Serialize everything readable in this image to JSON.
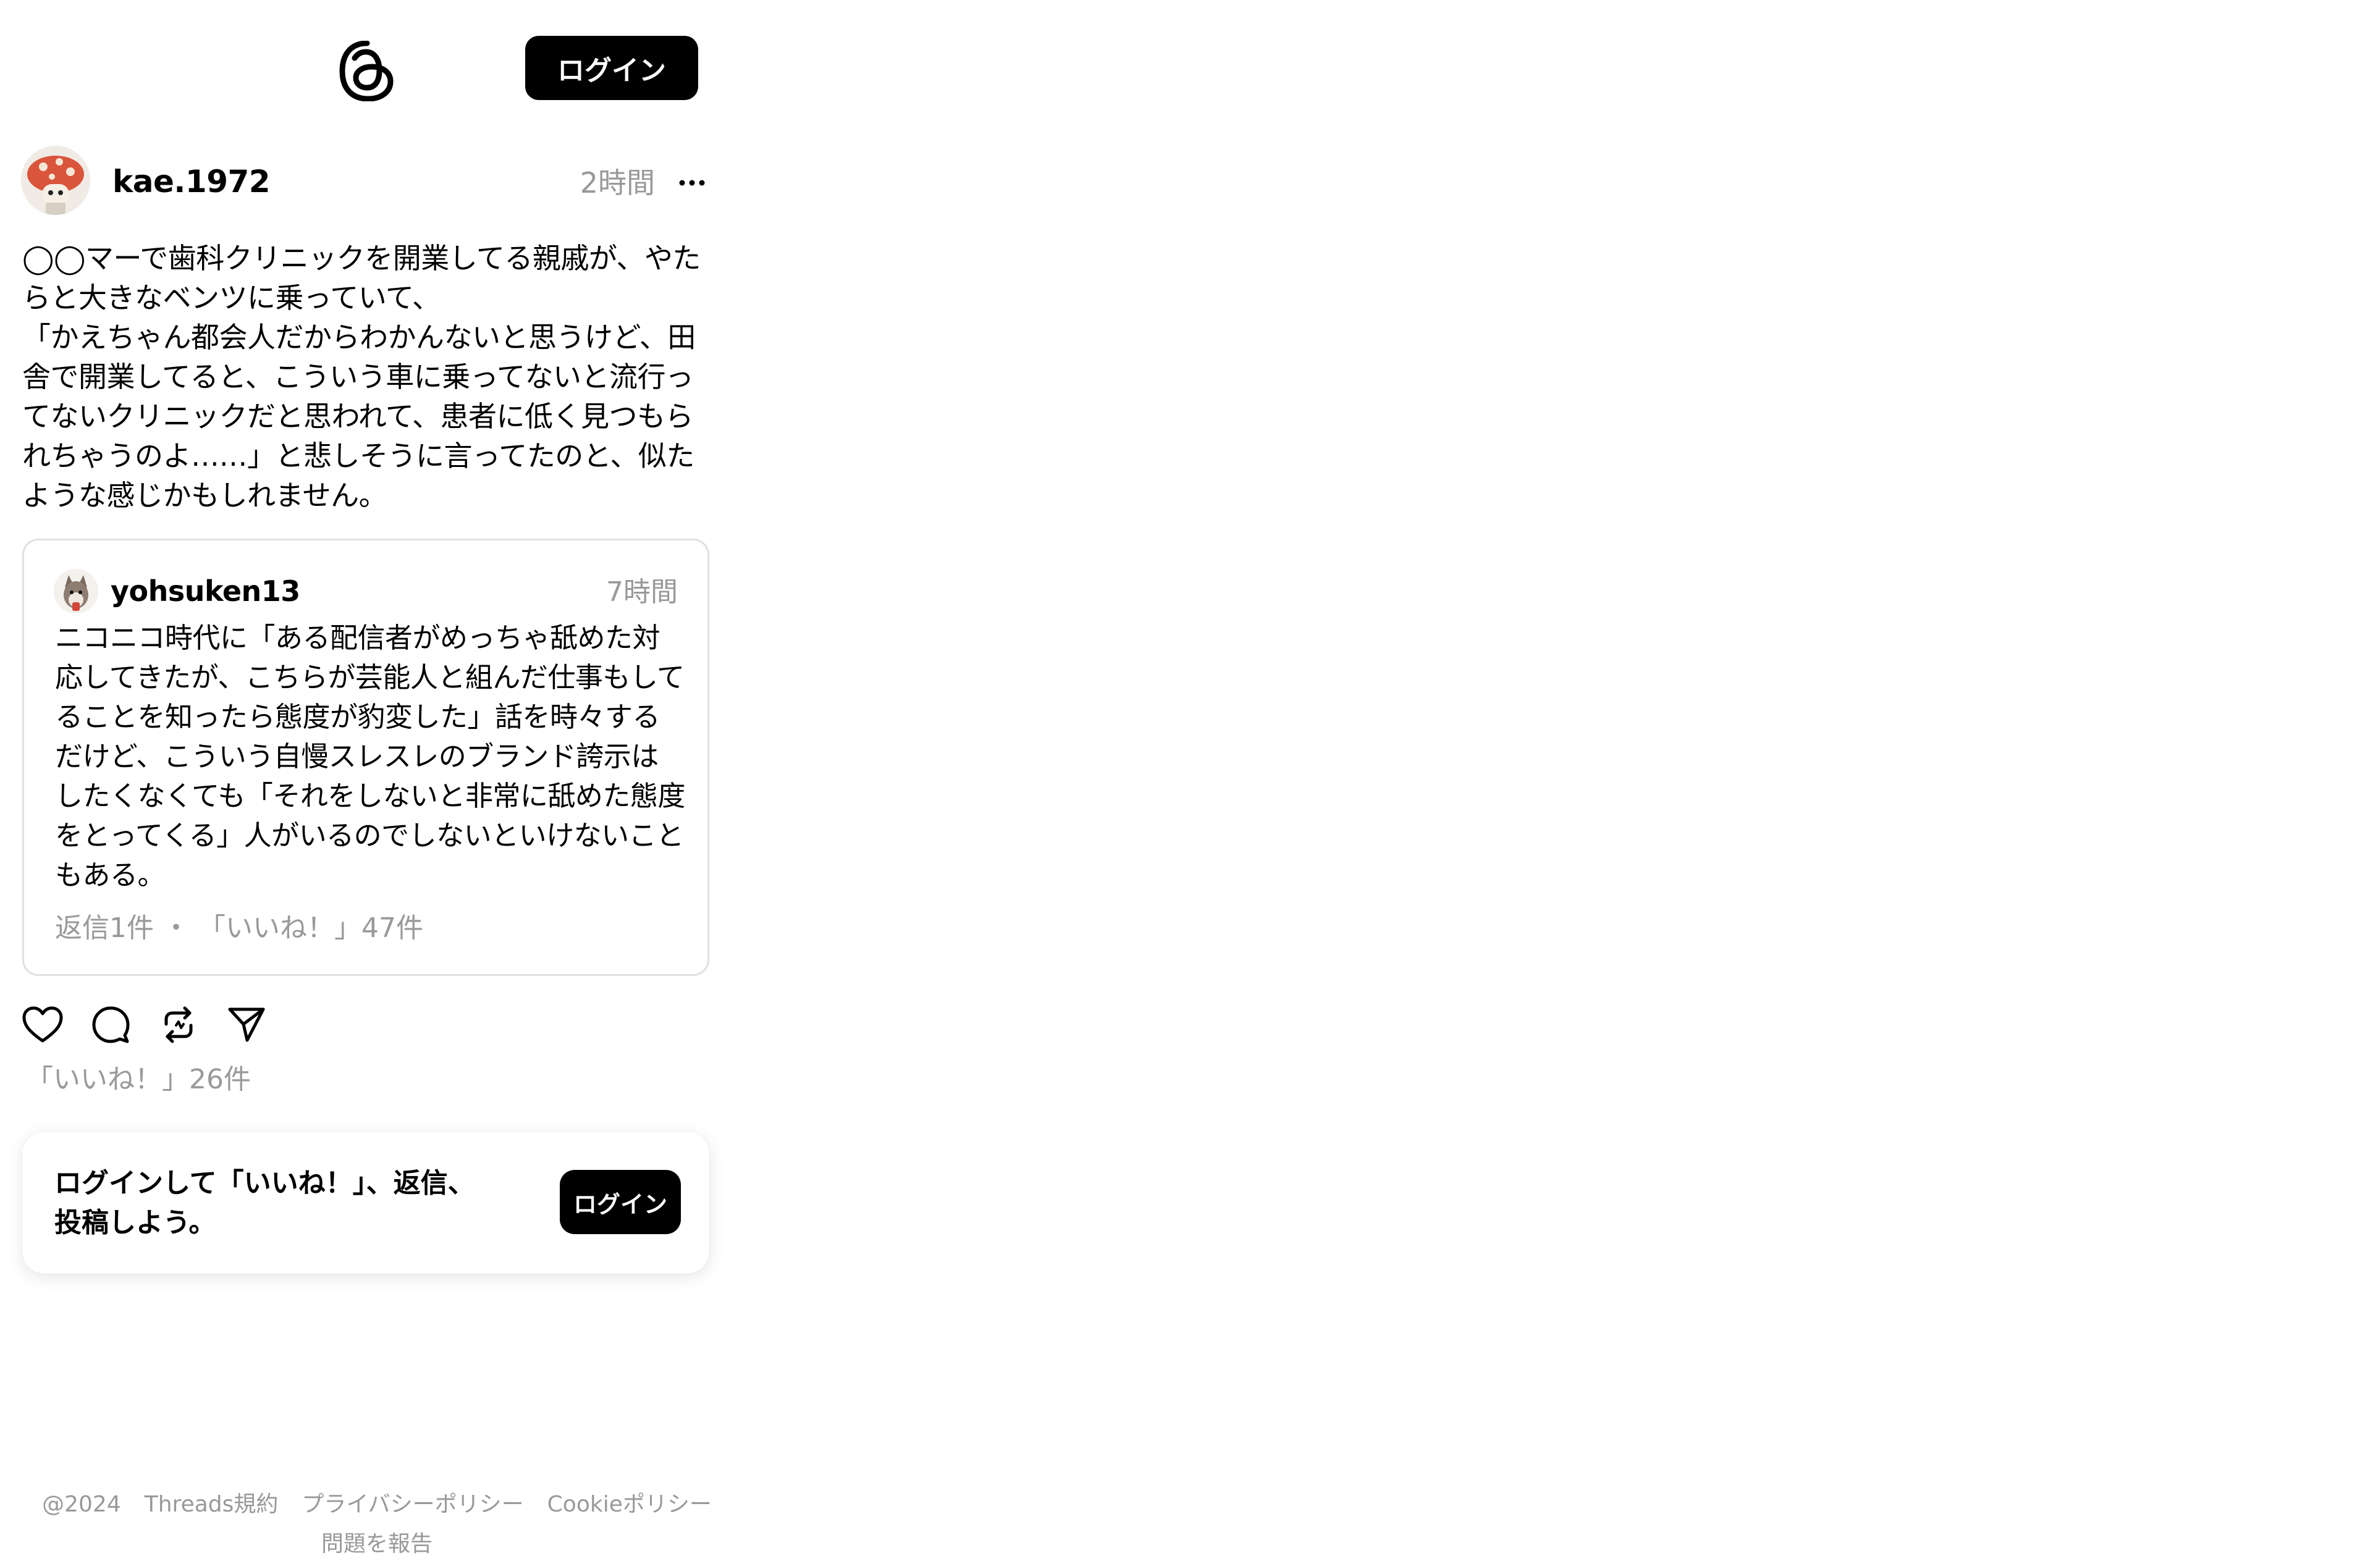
{
  "header": {
    "logo_icon": "threads-logo-icon",
    "login_label": "ログイン"
  },
  "post": {
    "username": "kae.1972",
    "time": "2時間",
    "more_icon": "more-options-icon",
    "text": "◯◯マーで歯科クリニックを開業してる親戚が、やたらと大きなベンツに乗っていて、\n「かえちゃん都会人だからわかんないと思うけど、田舎で開業してると、こういう車に乗ってないと流行ってないクリニックだと思われて、患者に低く見つもられちゃうのよ……」と悲しそうに言ってたのと、似たような感じかもしれません。",
    "likes": "「いいね！」26件"
  },
  "quote": {
    "username": "yohsuken13",
    "time": "7時間",
    "text": "ニコニコ時代に「ある配信者がめっちゃ舐めた対応してきたが、こちらが芸能人と組んだ仕事もしてることを知ったら態度が豹変した」話を時々するだけど、こういう自慢スレスレのブランド誇示はしたくなくても「それをしないと非常に舐めた態度をとってくる」人がいるのでしないといけないこともある。",
    "stats": "返信1件 ・ 「いいね！」47件"
  },
  "actions": [
    {
      "name": "like-icon"
    },
    {
      "name": "reply-icon"
    },
    {
      "name": "repost-icon"
    },
    {
      "name": "share-icon"
    }
  ],
  "login_card": {
    "text": "ログインして「いいね！」、返信、\n投稿しよう。",
    "button_label": "ログイン"
  },
  "footer": {
    "copyright": "@2024",
    "terms": "Threads規約",
    "privacy": "プライバシーポリシー",
    "cookie": "Cookieポリシー",
    "report": "問題を報告"
  }
}
